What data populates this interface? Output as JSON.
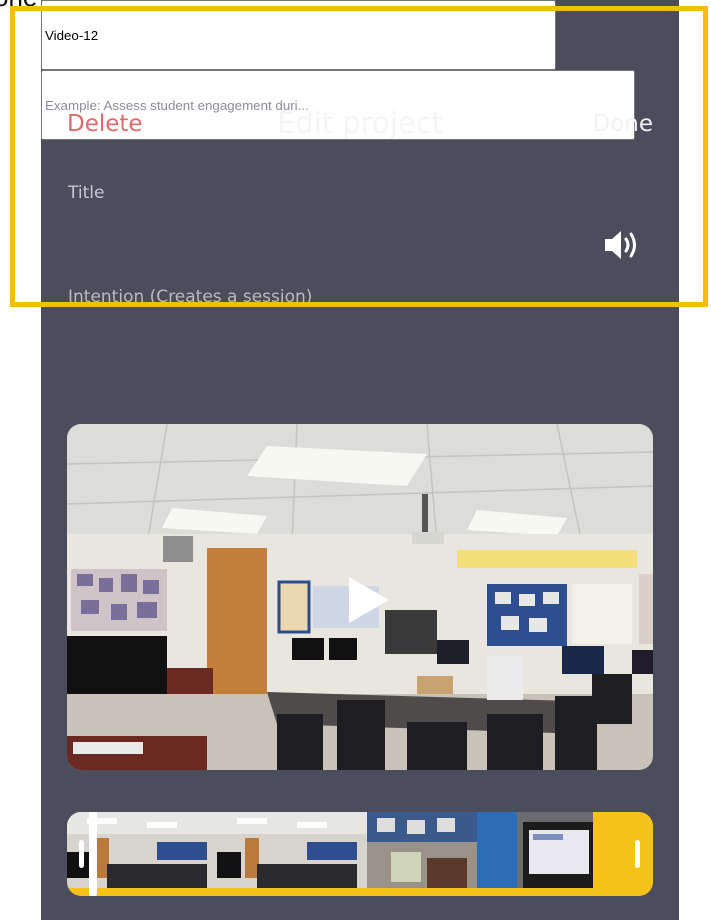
{
  "corner_text": "one",
  "header": {
    "delete_label": "Delete",
    "title": "Edit project",
    "done_label": "Done"
  },
  "form": {
    "title_label": "Title",
    "title_value": "Video-12",
    "intention_label": "Intention (Creates a session)",
    "intention_placeholder": "Example: Assess student engagement duri..."
  },
  "icons": {
    "speaker": "speaker-volume-icon",
    "play": "play-icon"
  },
  "colors": {
    "background": "#4b4c5c",
    "delete": "#e06a6a",
    "input_bg": "#5d5e6e",
    "timeline_border": "#f5c21c",
    "highlight_box": "#f7bd0a"
  }
}
